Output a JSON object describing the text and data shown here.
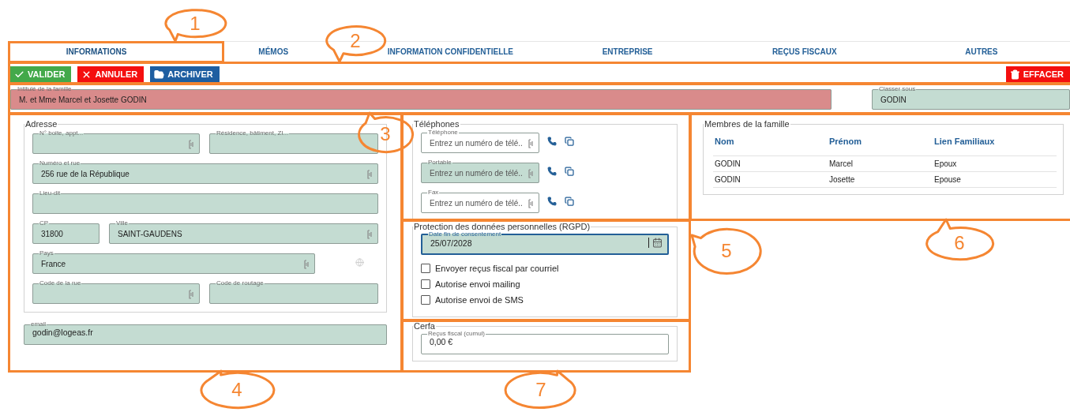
{
  "tabs": [
    {
      "label": "INFORMATIONS",
      "selected": true
    },
    {
      "label": "MÉMOS",
      "selected": false
    },
    {
      "label": "INFORMATION CONFIDENTIELLE",
      "selected": false
    },
    {
      "label": "ENTREPRISE",
      "selected": false
    },
    {
      "label": "REÇUS FISCAUX",
      "selected": false
    },
    {
      "label": "AUTRES",
      "selected": false
    }
  ],
  "toolbar": {
    "actions": [
      {
        "label": "VALIDER",
        "kind": "validate"
      },
      {
        "label": "ANNULER",
        "kind": "cancel"
      },
      {
        "label": "ARCHIVER",
        "kind": "archive"
      }
    ],
    "delete": {
      "label": "EFFACER",
      "kind": "delete"
    }
  },
  "family": {
    "title": {
      "label": "Intitulé de la famille",
      "value": "M. et Mme Marcel et Josette GODIN",
      "invalid": true
    },
    "sort_as": {
      "label": "Classer sous",
      "value": "GODIN",
      "invalid": false
    }
  },
  "address": {
    "legend": "Adresse",
    "rows": [
      [
        {
          "label": "N° boite, appt...",
          "picker": true
        },
        {
          "label": "Résidence, bâtiment, ZI...",
          "picker": false
        }
      ],
      [
        {
          "label": "Numéro et rue",
          "value": "256 rue de la République",
          "picker": true
        }
      ],
      [
        {
          "label": "Lieu-dit",
          "picker": false
        }
      ],
      [
        {
          "label": "CP",
          "value": "31800",
          "picker": false
        },
        {
          "label": "Ville",
          "value": "SAINT-GAUDENS",
          "picker": true
        }
      ],
      [
        {
          "label": "Pays",
          "value": "France",
          "picker": true
        }
      ],
      [
        {
          "label": "Code de la rue",
          "picker": true
        },
        {
          "label": "Code de routage",
          "picker": false
        }
      ]
    ]
  },
  "email": {
    "label": "email",
    "value": "godin@logeas.fr"
  },
  "phones": {
    "legend": "Téléphones",
    "items": [
      {
        "label": "Téléphone",
        "placeholder": "Entrez un numéro de télé..",
        "highlighted": false
      },
      {
        "label": "Portable",
        "placeholder": "Entrez un numéro de télé..",
        "highlighted": true
      },
      {
        "label": "Fax",
        "placeholder": "Entrez un numéro de télé..",
        "highlighted": false
      }
    ]
  },
  "rgpd": {
    "legend": "Protection des données personnelles (RGPD)",
    "date": {
      "label": "Date fin de consentement",
      "value": "25/07/2028",
      "focused": true
    },
    "options": [
      {
        "label": "Envoyer reçus fiscal par courriel",
        "checked": false
      },
      {
        "label": "Autorise envoi mailing",
        "checked": false
      },
      {
        "label": "Autorise envoi de SMS",
        "checked": false
      }
    ]
  },
  "cerfa": {
    "legend": "Cerfa",
    "field": {
      "label": "Reçus fiscal (cumul)",
      "value": "0,00 €"
    }
  },
  "members": {
    "legend": "Membres de la famille",
    "columns": [
      "Nom",
      "Prénom",
      "Lien Familiaux"
    ],
    "rows": [
      [
        "GODIN",
        "Marcel",
        "Epoux"
      ],
      [
        "GODIN",
        "Josette",
        "Epouse"
      ]
    ]
  },
  "annotations": [
    {
      "label": "1"
    },
    {
      "label": "2"
    },
    {
      "label": "3"
    },
    {
      "label": "4"
    },
    {
      "label": "5"
    },
    {
      "label": "6"
    },
    {
      "label": "7"
    }
  ]
}
